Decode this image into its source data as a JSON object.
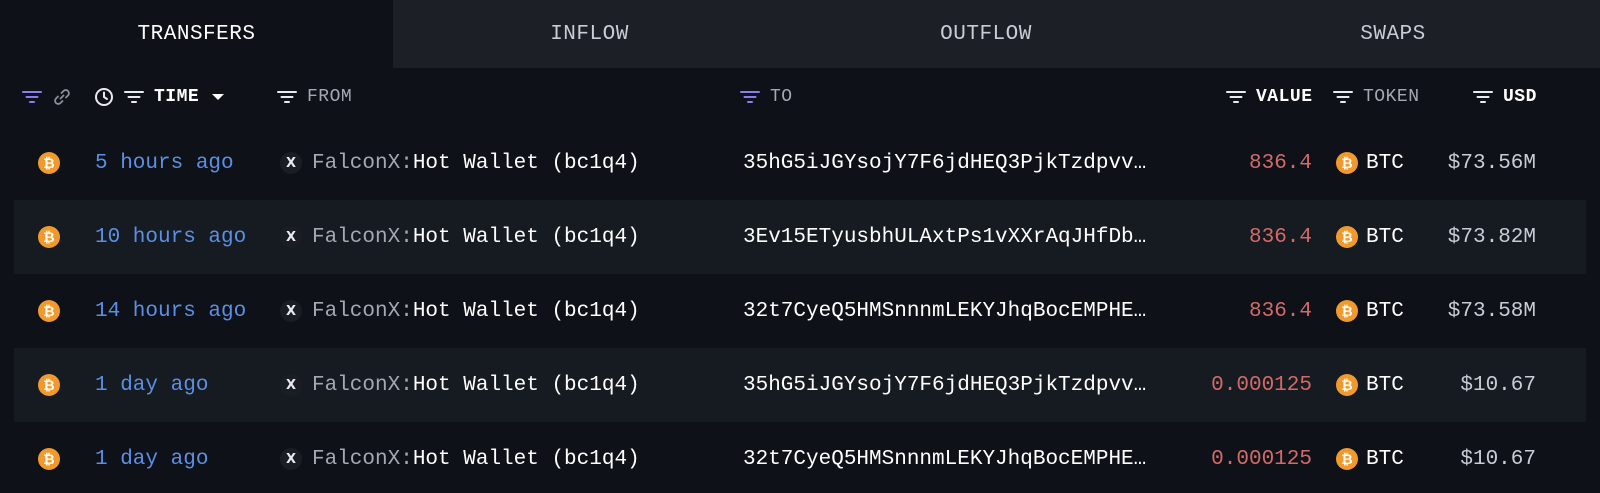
{
  "tabs": [
    "TRANSFERS",
    "INFLOW",
    "OUTFLOW",
    "SWAPS"
  ],
  "active_tab": "TRANSFERS",
  "columns": {
    "time": "TIME",
    "from": "FROM",
    "to": "TO",
    "value": "VALUE",
    "token": "TOKEN",
    "usd": "USD"
  },
  "colors": {
    "accent_purple": "#8c7cf0",
    "time_blue": "#5b8fe6",
    "value_red": "#d36a68",
    "btc_orange": "#f09a2e"
  },
  "rows": [
    {
      "time": "5 hours ago",
      "from_entity": "FalconX:",
      "from_wallet": " Hot Wallet (bc1q4)",
      "to": "35hG5iJGYsojY7F6jdHEQ3PjkTzdpvv…",
      "value": "836.4",
      "token": "BTC",
      "usd": "$73.56M"
    },
    {
      "time": "10 hours ago",
      "from_entity": "FalconX:",
      "from_wallet": " Hot Wallet (bc1q4)",
      "to": "3Ev15ETyusbhULAxtPs1vXXrAqJHfDb…",
      "value": "836.4",
      "token": "BTC",
      "usd": "$73.82M"
    },
    {
      "time": "14 hours ago",
      "from_entity": "FalconX:",
      "from_wallet": " Hot Wallet (bc1q4)",
      "to": "32t7CyeQ5HMSnnnmLEKYJhqBocEMPHE…",
      "value": "836.4",
      "token": "BTC",
      "usd": "$73.58M"
    },
    {
      "time": "1 day ago",
      "from_entity": "FalconX:",
      "from_wallet": " Hot Wallet (bc1q4)",
      "to": "35hG5iJGYsojY7F6jdHEQ3PjkTzdpvv…",
      "value": "0.000125",
      "token": "BTC",
      "usd": "$10.67"
    },
    {
      "time": "1 day ago",
      "from_entity": "FalconX:",
      "from_wallet": " Hot Wallet (bc1q4)",
      "to": "32t7CyeQ5HMSnnnmLEKYJhqBocEMPHE…",
      "value": "0.000125",
      "token": "BTC",
      "usd": "$10.67"
    }
  ]
}
